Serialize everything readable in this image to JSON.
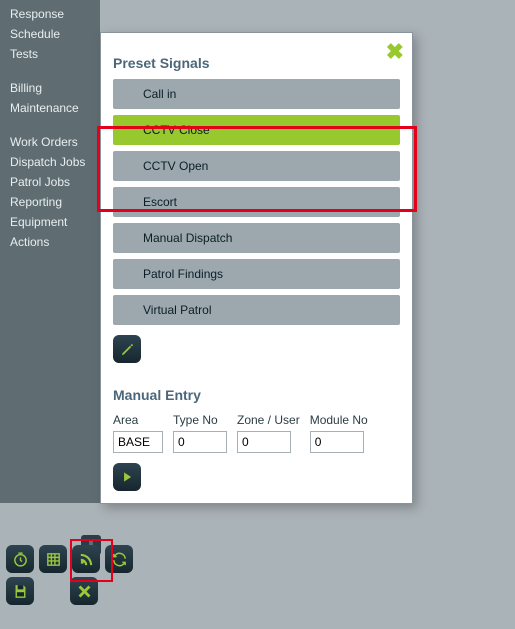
{
  "sidebar": {
    "group1": [
      "Response",
      "Schedule",
      "Tests"
    ],
    "group2": [
      "Billing",
      "Maintenance"
    ],
    "group3": [
      "Work Orders",
      "Dispatch Jobs",
      "Patrol Jobs",
      "Reporting",
      "Equipment",
      "Actions"
    ]
  },
  "dialog": {
    "title": "Preset Signals",
    "presets": [
      {
        "label": "Call in",
        "selected": false
      },
      {
        "label": "CCTV Close",
        "selected": true
      },
      {
        "label": "CCTV Open",
        "selected": false
      },
      {
        "label": "Escort",
        "selected": false
      },
      {
        "label": "Manual Dispatch",
        "selected": false
      },
      {
        "label": "Patrol Findings",
        "selected": false
      },
      {
        "label": "Virtual Patrol",
        "selected": false
      }
    ],
    "manual": {
      "title": "Manual Entry",
      "cols": [
        {
          "label": "Area",
          "value": "BASE"
        },
        {
          "label": "Type No",
          "value": "0"
        },
        {
          "label": "Zone / User",
          "value": "0"
        },
        {
          "label": "Module No",
          "value": "0"
        }
      ]
    }
  },
  "bottom_icons": [
    "clock-icon",
    "grid-icon",
    "rss-icon",
    "refresh-icon"
  ],
  "bottom_icons2": [
    "save-icon",
    "close-icon"
  ]
}
